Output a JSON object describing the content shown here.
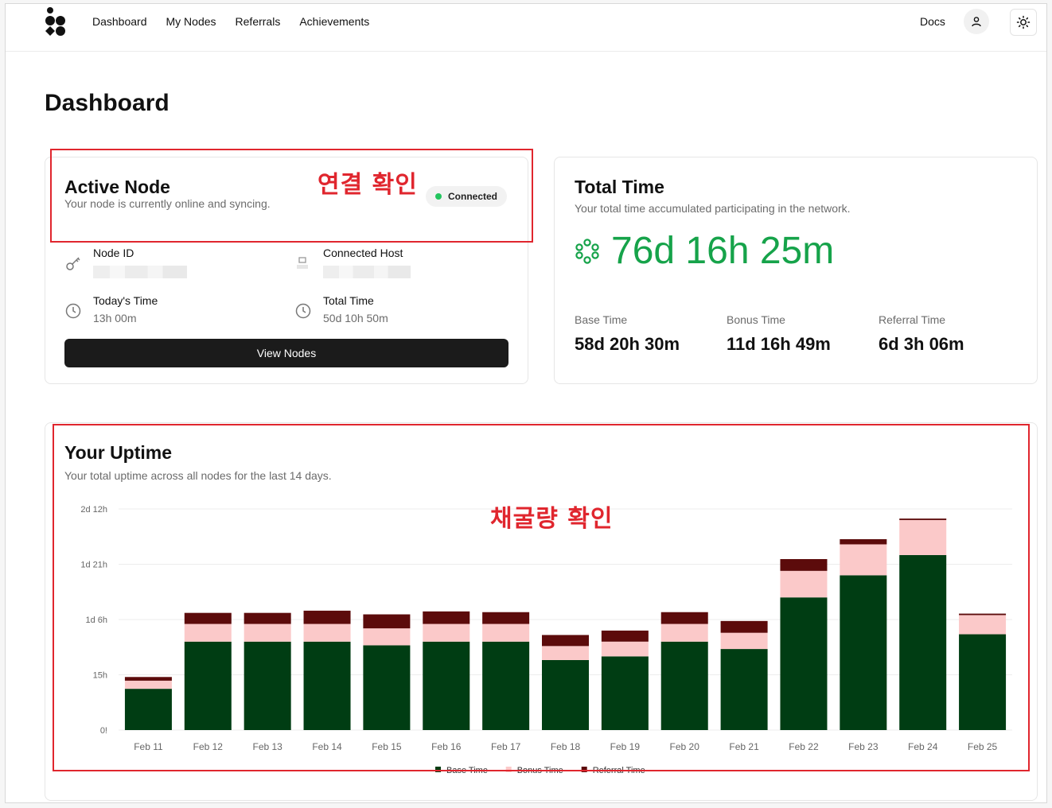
{
  "nav": {
    "links": [
      "Dashboard",
      "My Nodes",
      "Referrals",
      "Achievements"
    ],
    "docs": "Docs"
  },
  "page": {
    "title": "Dashboard"
  },
  "active_node": {
    "title": "Active Node",
    "subtitle": "Your node is currently online and syncing.",
    "status": "Connected",
    "node_id_label": "Node ID",
    "connected_host_label": "Connected Host",
    "todays_time_label": "Today's Time",
    "todays_time": "13h 00m",
    "total_time_label": "Total Time",
    "total_time": "50d 10h 50m",
    "view_button": "View Nodes"
  },
  "total_time": {
    "title": "Total Time",
    "subtitle": "Your total time accumulated participating in the network.",
    "value": "76d 16h 25m",
    "base_label": "Base Time",
    "base_value": "58d 20h 30m",
    "bonus_label": "Bonus Time",
    "bonus_value": "11d 16h 49m",
    "referral_label": "Referral Time",
    "referral_value": "6d 3h 06m"
  },
  "uptime": {
    "title": "Your Uptime",
    "subtitle": "Your total uptime across all nodes for the last 14 days."
  },
  "annotations": {
    "connection": "연결 확인",
    "mining": "채굴량 확인"
  },
  "colors": {
    "accent_green": "#16a34a",
    "base": "#003d13",
    "bonus": "#fbc9c9",
    "referral": "#5c0b0b",
    "annotation": "#e0262e"
  },
  "chart_data": {
    "type": "bar",
    "stacked": true,
    "categories": [
      "Feb 11",
      "Feb 12",
      "Feb 13",
      "Feb 14",
      "Feb 15",
      "Feb 16",
      "Feb 17",
      "Feb 18",
      "Feb 19",
      "Feb 20",
      "Feb 21",
      "Feb 22",
      "Feb 23",
      "Feb 24",
      "Feb 25"
    ],
    "y_ticks": [
      "0!",
      "15h",
      "1d 6h",
      "1d 21h",
      "2d 12h"
    ],
    "ylim_hours": [
      0,
      60
    ],
    "series": [
      {
        "name": "Base Time",
        "color": "#003d13",
        "values": [
          11.2,
          24,
          24,
          24,
          23,
          24,
          24,
          19,
          20,
          24,
          22,
          36,
          42,
          47.5,
          26
        ]
      },
      {
        "name": "Bonus Time",
        "color": "#fbc9c9",
        "values": [
          2.2,
          4.8,
          4.8,
          4.8,
          4.6,
          4.8,
          4.8,
          3.8,
          4.0,
          4.8,
          4.4,
          7.2,
          8.4,
          9.5,
          5.2
        ]
      },
      {
        "name": "Referral Time",
        "color": "#5c0b0b",
        "values": [
          1.0,
          3.0,
          3.0,
          3.6,
          3.8,
          3.4,
          3.2,
          3.0,
          3.0,
          3.2,
          3.2,
          3.2,
          1.4,
          0.4,
          0.4
        ]
      }
    ],
    "legend": "bottom-center",
    "grid": true
  }
}
